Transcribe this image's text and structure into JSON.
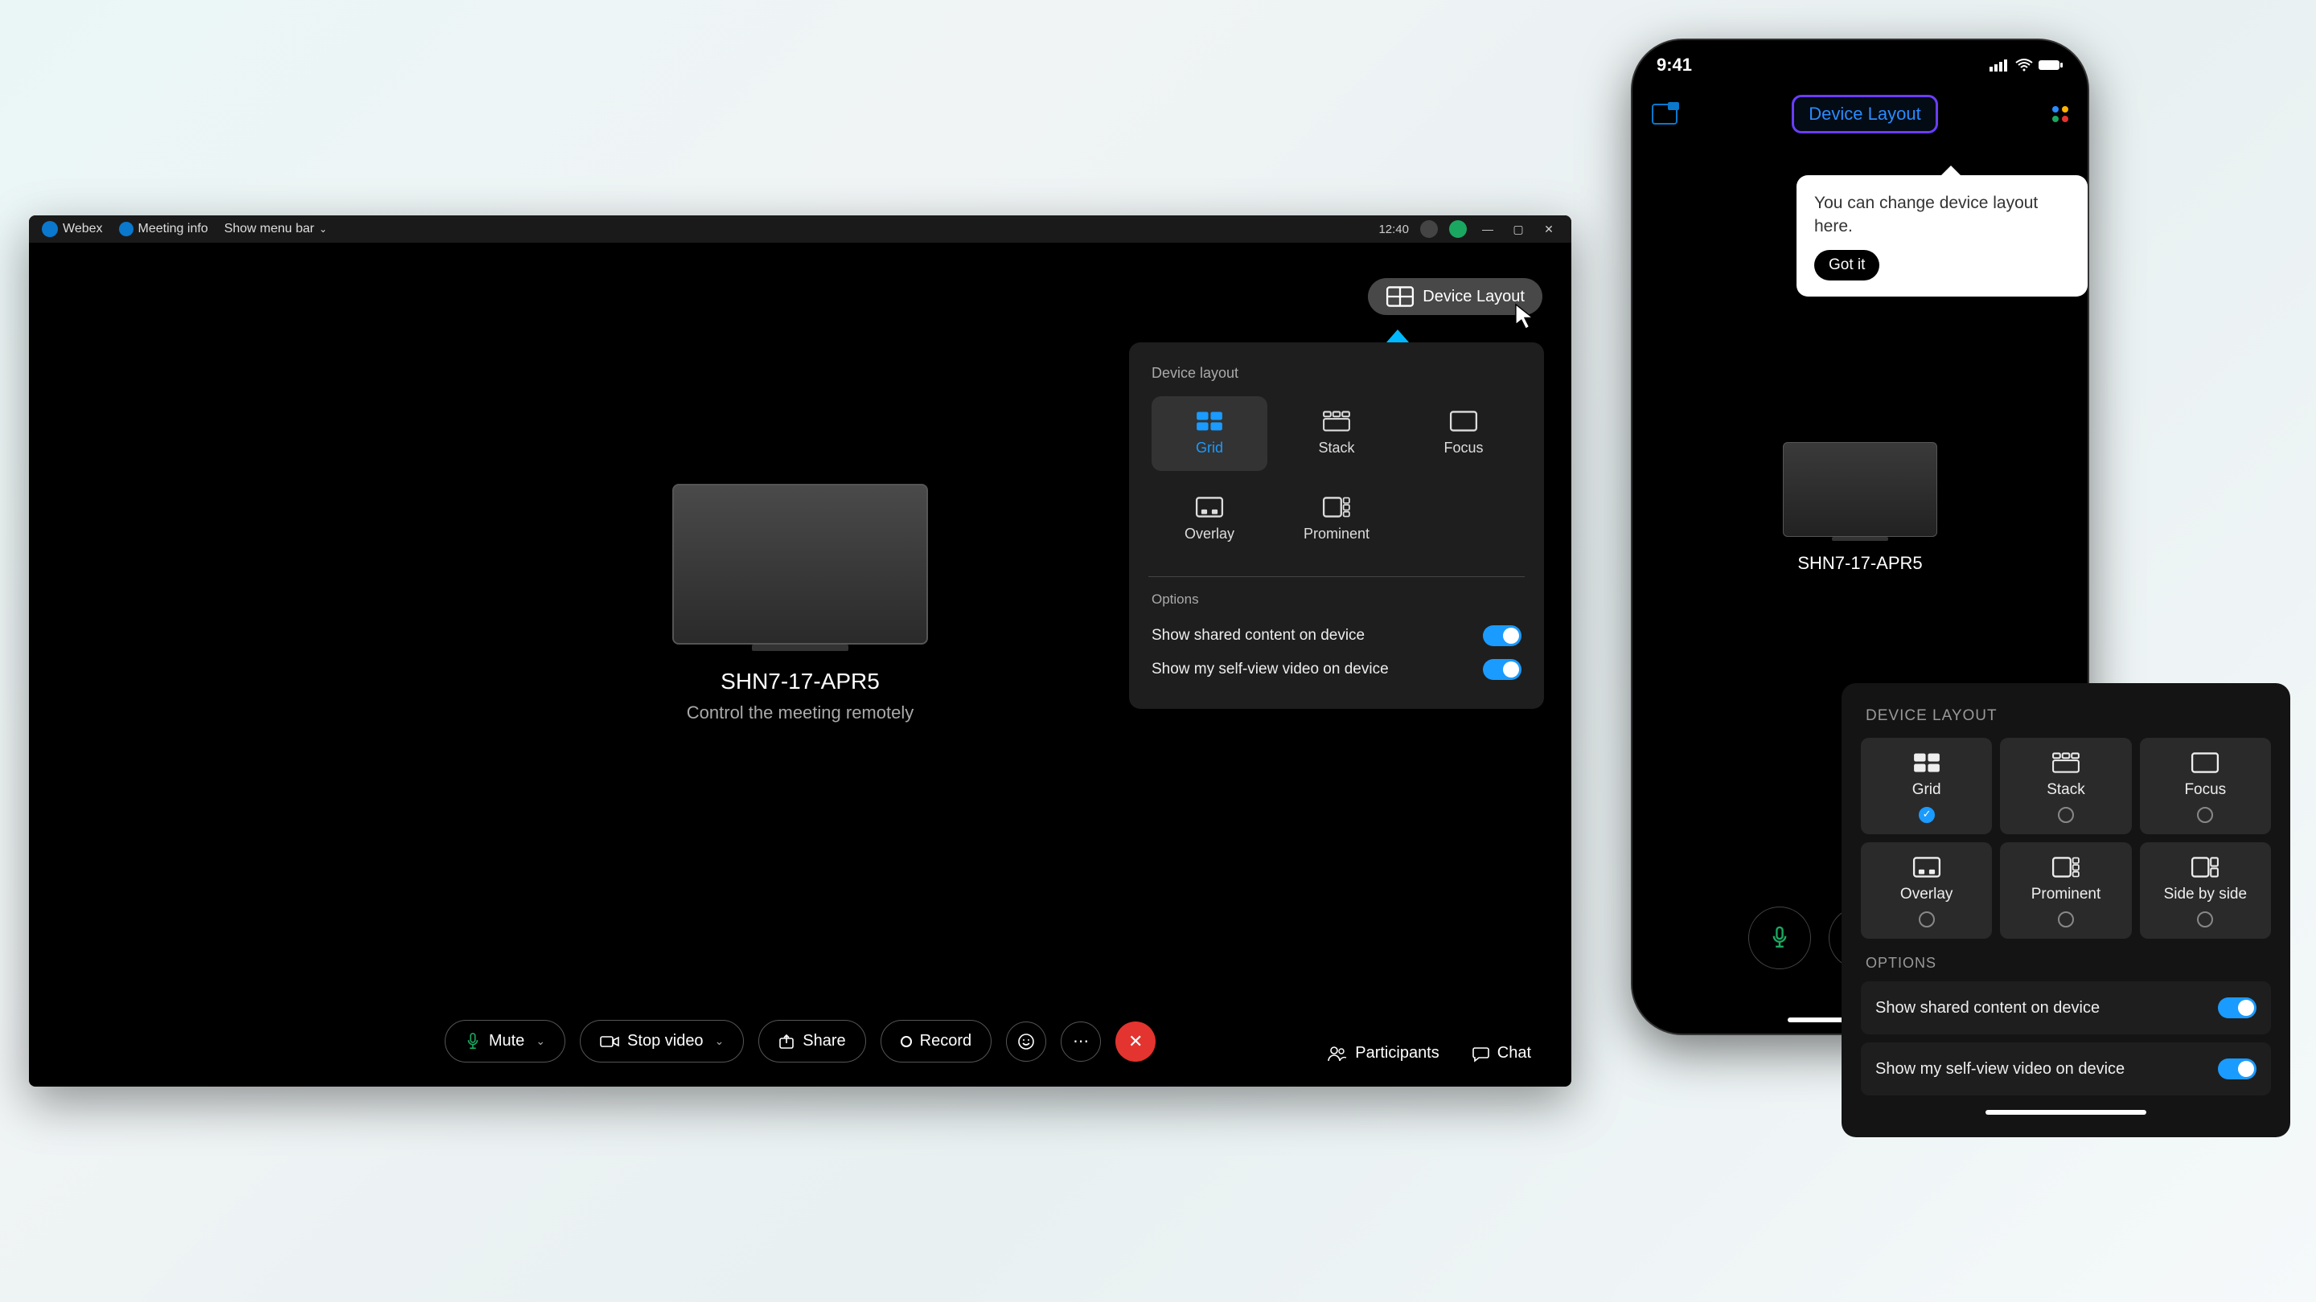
{
  "desktop": {
    "titlebar": {
      "app": "Webex",
      "meeting_info": "Meeting info",
      "show_menu": "Show menu bar",
      "time": "12:40"
    },
    "device_layout_btn": "Device Layout",
    "center": {
      "name": "SHN7-17-APR5",
      "sub": "Control the meeting remotely"
    },
    "popover": {
      "title": "Device layout",
      "layouts": [
        "Grid",
        "Stack",
        "Focus",
        "Overlay",
        "Prominent"
      ],
      "options_title": "Options",
      "opt1": "Show shared content on device",
      "opt2": "Show my self-view video on device"
    },
    "toolbar": {
      "mute": "Mute",
      "stop_video": "Stop video",
      "share": "Share",
      "record": "Record",
      "participants": "Participants",
      "chat": "Chat"
    }
  },
  "phone": {
    "time": "9:41",
    "layout_btn": "Device Layout",
    "tooltip": {
      "text": "You can change device layout here.",
      "btn": "Got it"
    },
    "device_name": "SHN7-17-APR5"
  },
  "mobile_sheet": {
    "title": "DEVICE LAYOUT",
    "layouts": [
      "Grid",
      "Stack",
      "Focus",
      "Overlay",
      "Prominent",
      "Side by side"
    ],
    "options_title": "OPTIONS",
    "opt1": "Show shared content on device",
    "opt2": "Show my self-view video on device"
  }
}
